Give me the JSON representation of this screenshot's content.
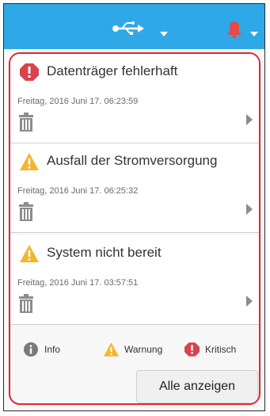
{
  "topbar": {
    "usb_icon": "usb-icon",
    "bell_icon": "bell-icon",
    "bell_color": "#e34b4b",
    "bar_color": "#2fa8e8"
  },
  "alerts": [
    {
      "level": "kritisch",
      "icon": "critical-icon",
      "title": "Datenträger fehlerhaft",
      "time": "Freitag, 2016 Juni 17. 06:23:59"
    },
    {
      "level": "warnung",
      "icon": "warning-icon",
      "title": "Ausfall der Stromversorgung",
      "time": "Freitag, 2016 Juni 17. 06:25:32"
    },
    {
      "level": "warnung",
      "icon": "warning-icon",
      "title": "System nicht bereit",
      "time": "Freitag, 2016 Juni 17. 03:57:51"
    }
  ],
  "legend": {
    "info": "Info",
    "warning": "Warnung",
    "critical": "Kritisch"
  },
  "show_all_label": "Alle anzeigen",
  "colors": {
    "critical": "#d8434e",
    "warning": "#f2b72d",
    "info": "#7a7a7a",
    "panel_border": "#e0262f"
  }
}
